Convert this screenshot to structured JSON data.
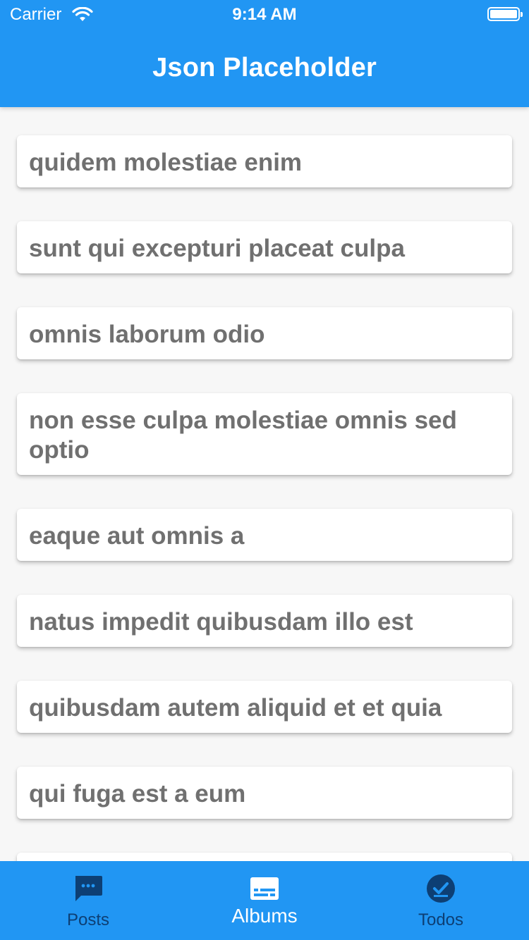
{
  "status_bar": {
    "carrier": "Carrier",
    "time": "9:14 AM"
  },
  "app_bar": {
    "title": "Json Placeholder"
  },
  "albums": [
    {
      "title": "quidem molestiae enim"
    },
    {
      "title": "sunt qui excepturi placeat culpa"
    },
    {
      "title": "omnis laborum odio"
    },
    {
      "title": "non esse culpa molestiae omnis sed optio"
    },
    {
      "title": "eaque aut omnis a"
    },
    {
      "title": "natus impedit quibusdam illo est"
    },
    {
      "title": "quibusdam autem aliquid et et quia"
    },
    {
      "title": "qui fuga est a eum"
    }
  ],
  "bottom_nav": {
    "items": [
      {
        "label": "Posts",
        "icon": "message-icon",
        "active": false
      },
      {
        "label": "Albums",
        "icon": "subtitles-icon",
        "active": true
      },
      {
        "label": "Todos",
        "icon": "check-circle-icon",
        "active": false
      }
    ]
  },
  "colors": {
    "primary": "#2196f3",
    "inactive_icon": "#0d3f74",
    "active_icon": "#ffffff",
    "card_text": "#707070",
    "background": "#f7f7f7"
  }
}
